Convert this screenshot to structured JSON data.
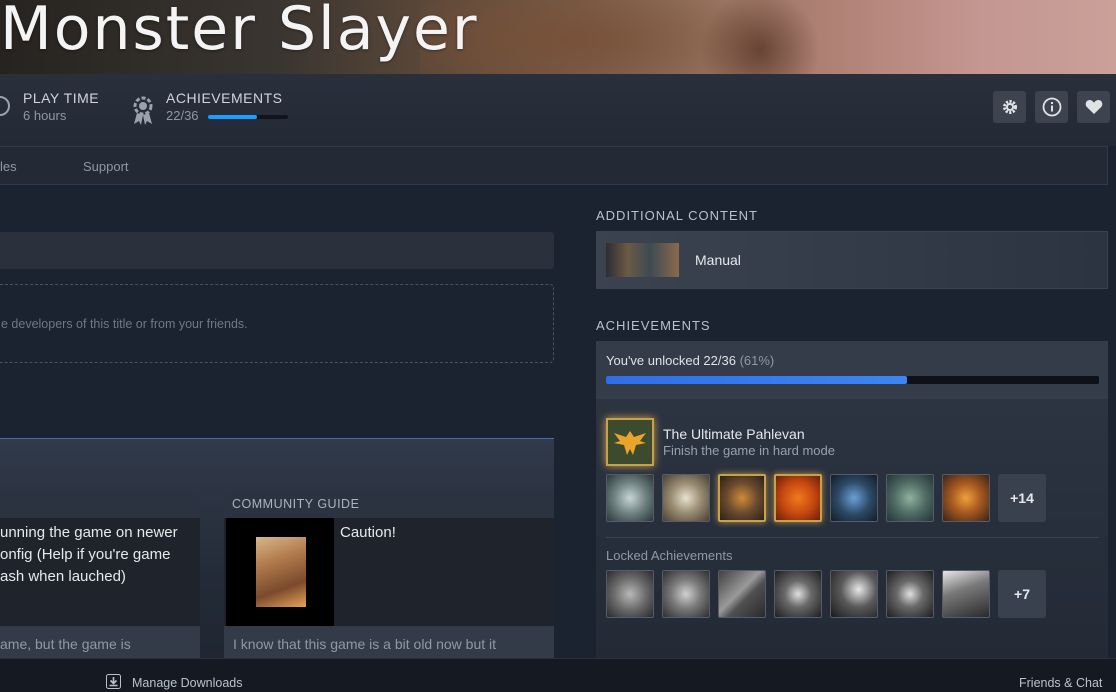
{
  "game": {
    "title": "Monster Slayer"
  },
  "stats": {
    "playtime_label": "PLAY TIME",
    "playtime_value": "6 hours",
    "achievements_label": "ACHIEVEMENTS",
    "achievements_value": "22/36",
    "achievements_progress": 0.61
  },
  "tabs": [
    {
      "label": "les"
    },
    {
      "label": "Support"
    }
  ],
  "activity": {
    "empty_text": "e developers of this title or from your friends.",
    "cards": [
      {
        "text": "unning the game on newer\nonfig (Help if you're game\nash when lauched)",
        "foot": "ame, but the game is"
      },
      {
        "tag": "COMMUNITY GUIDE",
        "title": "Caution!",
        "foot": "I know that this game is a bit old now but it"
      }
    ]
  },
  "additional_content": {
    "heading": "ADDITIONAL CONTENT",
    "items": [
      {
        "label": "Manual"
      }
    ]
  },
  "achievements": {
    "heading": "ACHIEVEMENTS",
    "summary_prefix": "You've unlocked 22/36",
    "summary_pct": "(61%)",
    "progress": 0.61,
    "featured": {
      "title": "The Ultimate Pahlevan",
      "description": "Finish the game in hard mode"
    },
    "unlocked_more": "+14",
    "locked_label": "Locked Achievements",
    "locked_more": "+7"
  },
  "bottom": {
    "downloads": "Manage Downloads",
    "friends": "Friends & Chat"
  },
  "colors": {
    "accent": "#1a9fff",
    "gold": "#c8a14a"
  }
}
